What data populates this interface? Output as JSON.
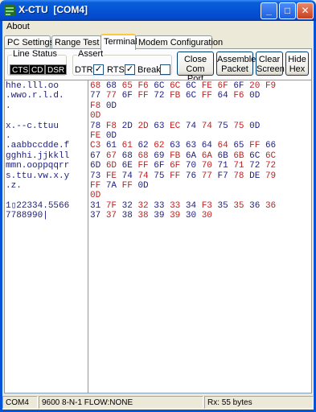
{
  "window": {
    "title": "X-CTU  [COM4]"
  },
  "menu": {
    "items": [
      "About"
    ]
  },
  "tabs": [
    "PC Settings",
    "Range Test",
    "Terminal",
    "Modem Configuration"
  ],
  "active_tab": "Terminal",
  "line_status": {
    "label": "Line Status",
    "leds": [
      "CTS",
      "CD",
      "DSR"
    ]
  },
  "assert": {
    "label": "Assert",
    "dtr": {
      "label": "DTR",
      "checked": true
    },
    "rts": {
      "label": "RTS",
      "checked": true
    },
    "break": {
      "label": "Break",
      "checked": false
    }
  },
  "buttons": {
    "close_com_port": [
      "Close",
      "Com Port"
    ],
    "assemble_packet": [
      "Assemble",
      "Packet"
    ],
    "clear_screen": [
      "Clear",
      "Screen"
    ],
    "hide_hex": [
      "Hide",
      "Hex"
    ]
  },
  "terminal": {
    "ascii_lines": [
      {
        "text": "hhe.lll.oo",
        "c": "tx"
      },
      {
        "text": ".wwo.r.l.d.",
        "c": "tx"
      },
      {
        "text": ".",
        "c": "tx"
      },
      {
        "text": "",
        "c": "tx"
      },
      {
        "text": "x.--c.ttuu",
        "c": "tx"
      },
      {
        "text": ".",
        "c": "tx"
      },
      {
        "text": ".aabbccdde.f",
        "c": "tx"
      },
      {
        "text": "gghhi.jjkkll",
        "c": "tx"
      },
      {
        "text": "mmn.ooppqqrr",
        "c": "tx"
      },
      {
        "text": "s.ttu.vw.x.y",
        "c": "tx"
      },
      {
        "text": ".z.",
        "c": "tx"
      },
      {
        "text": "",
        "c": "tx"
      },
      {
        "text": "1▯22334.5566",
        "c": "tx"
      },
      {
        "text": "7788990|",
        "c": "tx"
      }
    ],
    "hex_lines": [
      [
        [
          "68",
          "rx"
        ],
        [
          "68",
          "tx"
        ],
        [
          "65",
          "rx"
        ],
        [
          "F6",
          "rx"
        ],
        [
          "6C",
          "tx"
        ],
        [
          "6C",
          "rx"
        ],
        [
          "6C",
          "tx"
        ],
        [
          "FE",
          "rx"
        ],
        [
          "6F",
          "rx"
        ],
        [
          "6F",
          "tx"
        ],
        [
          "20",
          "rx"
        ],
        [
          "F9",
          "rx"
        ]
      ],
      [
        [
          "77",
          "tx"
        ],
        [
          "77",
          "rx"
        ],
        [
          "6F",
          "tx"
        ],
        [
          "FF",
          "rx"
        ],
        [
          "72",
          "tx"
        ],
        [
          "FB",
          "rx"
        ],
        [
          "6C",
          "tx"
        ],
        [
          "FF",
          "rx"
        ],
        [
          "64",
          "tx"
        ],
        [
          "F6",
          "rx"
        ],
        [
          "0D",
          "tx"
        ]
      ],
      [
        [
          "F8",
          "rx"
        ],
        [
          "0D",
          "tx"
        ]
      ],
      [
        [
          "0D",
          "rx"
        ]
      ],
      [
        [
          "78",
          "tx"
        ],
        [
          "F8",
          "rx"
        ],
        [
          "2D",
          "tx"
        ],
        [
          "2D",
          "rx"
        ],
        [
          "63",
          "tx"
        ],
        [
          "EC",
          "rx"
        ],
        [
          "74",
          "tx"
        ],
        [
          "74",
          "rx"
        ],
        [
          "75",
          "tx"
        ],
        [
          "75",
          "rx"
        ],
        [
          "0D",
          "tx"
        ]
      ],
      [
        [
          "FE",
          "rx"
        ],
        [
          "0D",
          "tx"
        ]
      ],
      [
        [
          "C3",
          "rx"
        ],
        [
          "61",
          "tx"
        ],
        [
          "61",
          "rx"
        ],
        [
          "62",
          "tx"
        ],
        [
          "62",
          "rx"
        ],
        [
          "63",
          "tx"
        ],
        [
          "63",
          "tx"
        ],
        [
          "64",
          "tx"
        ],
        [
          "64",
          "rx"
        ],
        [
          "65",
          "tx"
        ],
        [
          "FF",
          "rx"
        ],
        [
          "66",
          "tx"
        ]
      ],
      [
        [
          "67",
          "tx"
        ],
        [
          "67",
          "rx"
        ],
        [
          "68",
          "tx"
        ],
        [
          "68",
          "rx"
        ],
        [
          "69",
          "tx"
        ],
        [
          "FB",
          "rx"
        ],
        [
          "6A",
          "tx"
        ],
        [
          "6A",
          "rx"
        ],
        [
          "6B",
          "tx"
        ],
        [
          "6B",
          "rx"
        ],
        [
          "6C",
          "tx"
        ],
        [
          "6C",
          "rx"
        ]
      ],
      [
        [
          "6D",
          "tx"
        ],
        [
          "6D",
          "rx"
        ],
        [
          "6E",
          "tx"
        ],
        [
          "FF",
          "rx"
        ],
        [
          "6F",
          "tx"
        ],
        [
          "6F",
          "rx"
        ],
        [
          "70",
          "tx"
        ],
        [
          "70",
          "rx"
        ],
        [
          "71",
          "tx"
        ],
        [
          "71",
          "rx"
        ],
        [
          "72",
          "tx"
        ],
        [
          "72",
          "rx"
        ]
      ],
      [
        [
          "73",
          "tx"
        ],
        [
          "FE",
          "rx"
        ],
        [
          "74",
          "tx"
        ],
        [
          "74",
          "rx"
        ],
        [
          "75",
          "tx"
        ],
        [
          "FF",
          "rx"
        ],
        [
          "76",
          "tx"
        ],
        [
          "77",
          "rx"
        ],
        [
          "F7",
          "tx"
        ],
        [
          "78",
          "rx"
        ],
        [
          "DE",
          "tx"
        ],
        [
          "79",
          "rx"
        ]
      ],
      [
        [
          "FF",
          "rx"
        ],
        [
          "7A",
          "tx"
        ],
        [
          "FF",
          "rx"
        ],
        [
          "0D",
          "tx"
        ]
      ],
      [
        [
          "0D",
          "rx"
        ]
      ],
      [
        [
          "31",
          "tx"
        ],
        [
          "7F",
          "rx"
        ],
        [
          "32",
          "tx"
        ],
        [
          "32",
          "rx"
        ],
        [
          "33",
          "tx"
        ],
        [
          "33",
          "rx"
        ],
        [
          "34",
          "tx"
        ],
        [
          "F3",
          "rx"
        ],
        [
          "35",
          "tx"
        ],
        [
          "35",
          "rx"
        ],
        [
          "36",
          "tx"
        ],
        [
          "36",
          "rx"
        ]
      ],
      [
        [
          "37",
          "tx"
        ],
        [
          "37",
          "rx"
        ],
        [
          "38",
          "tx"
        ],
        [
          "38",
          "rx"
        ],
        [
          "39",
          "tx"
        ],
        [
          "39",
          "rx"
        ],
        [
          "30",
          "tx"
        ],
        [
          "30",
          "rx"
        ]
      ]
    ]
  },
  "status": {
    "port": "COM4",
    "settings": "9600 8-N-1  FLOW:NONE",
    "rx": "Rx: 55 bytes"
  }
}
